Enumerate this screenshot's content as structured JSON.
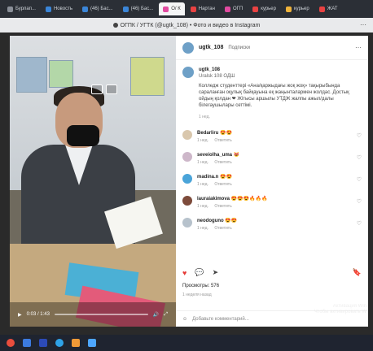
{
  "browser": {
    "tabs": [
      {
        "label": "Бурлап...",
        "fav_color": "#8a8f98",
        "active": false
      },
      {
        "label": "Новость",
        "fav_color": "#3b86d9",
        "active": false
      },
      {
        "label": "(46) Бас...",
        "fav_color": "#3b86d9",
        "active": false
      },
      {
        "label": "(46) Бас...",
        "fav_color": "#3b86d9",
        "active": false
      },
      {
        "label": "О/ К",
        "fav_color": "#e14aa0",
        "active": true
      },
      {
        "label": "Нартан",
        "fav_color": "#e94242",
        "active": false
      },
      {
        "label": "ОГП",
        "fav_color": "#e14aa0",
        "active": false
      },
      {
        "label": "курьер",
        "fav_color": "#e94242",
        "active": false
      },
      {
        "label": "курьер",
        "fav_color": "#f0b43c",
        "active": false
      },
      {
        "label": "ЖАТ",
        "fav_color": "#e94242",
        "active": false
      }
    ],
    "window_title": "ОГПК / УГТК (@ugtk_108) • Фото и видео в Instagram",
    "title_more": "⋯"
  },
  "video": {
    "time": "0:03 / 1:43",
    "play_icon": "play-icon",
    "volume_icon": "volume-icon",
    "fullscreen_icon": "fullscreen-icon"
  },
  "post": {
    "header_username": "ugtk_108",
    "header_follow": "Подписки",
    "caption_username": "ugtk_108",
    "caption_meta": "Uralsk 108 ОДШ",
    "caption_text": "Колледж студенттері «Ана/қаржыдағы жоқ жоқ» тақырыбында сараланған оқулық байқауына еқ жаңынталармен жолдас. Достық ойдың қолдан ❤ Жітысы аршылы УТДЖ жалпы ажыл/далы білегаушылары сеттімі.",
    "caption_time": "1 нед.",
    "comments": [
      {
        "username": "Bedarliru",
        "text": "😍😍",
        "time": "1 нед.",
        "reply": "Ответить"
      },
      {
        "username": "seveiolha_uma",
        "text": "😻",
        "time": "1 нед.",
        "reply": "Ответить"
      },
      {
        "username": "madina.n",
        "text": "😍😍",
        "time": "1 нед.",
        "reply": "Ответить"
      },
      {
        "username": "lauraiakimova",
        "text": "😍😍😍🔥🔥🔥",
        "time": "1 нед.",
        "reply": "Ответить"
      },
      {
        "username": "neodoguno",
        "text": "😍😍",
        "time": "1 нед.",
        "reply": "Ответить"
      }
    ],
    "views_label": "Просмотры: 576",
    "views_time": "1 неделя назад",
    "add_comment_placeholder": "Добавьте комментарий...",
    "activate_text_1": "Активация Win",
    "activate_text_2": "Чтобы активировать W"
  },
  "taskbar": {
    "icons": [
      "#e84d3d",
      "#3c7be0",
      "#2c4ab7",
      "#2fa3e8",
      "#f09a37",
      "#4da6ff"
    ]
  }
}
